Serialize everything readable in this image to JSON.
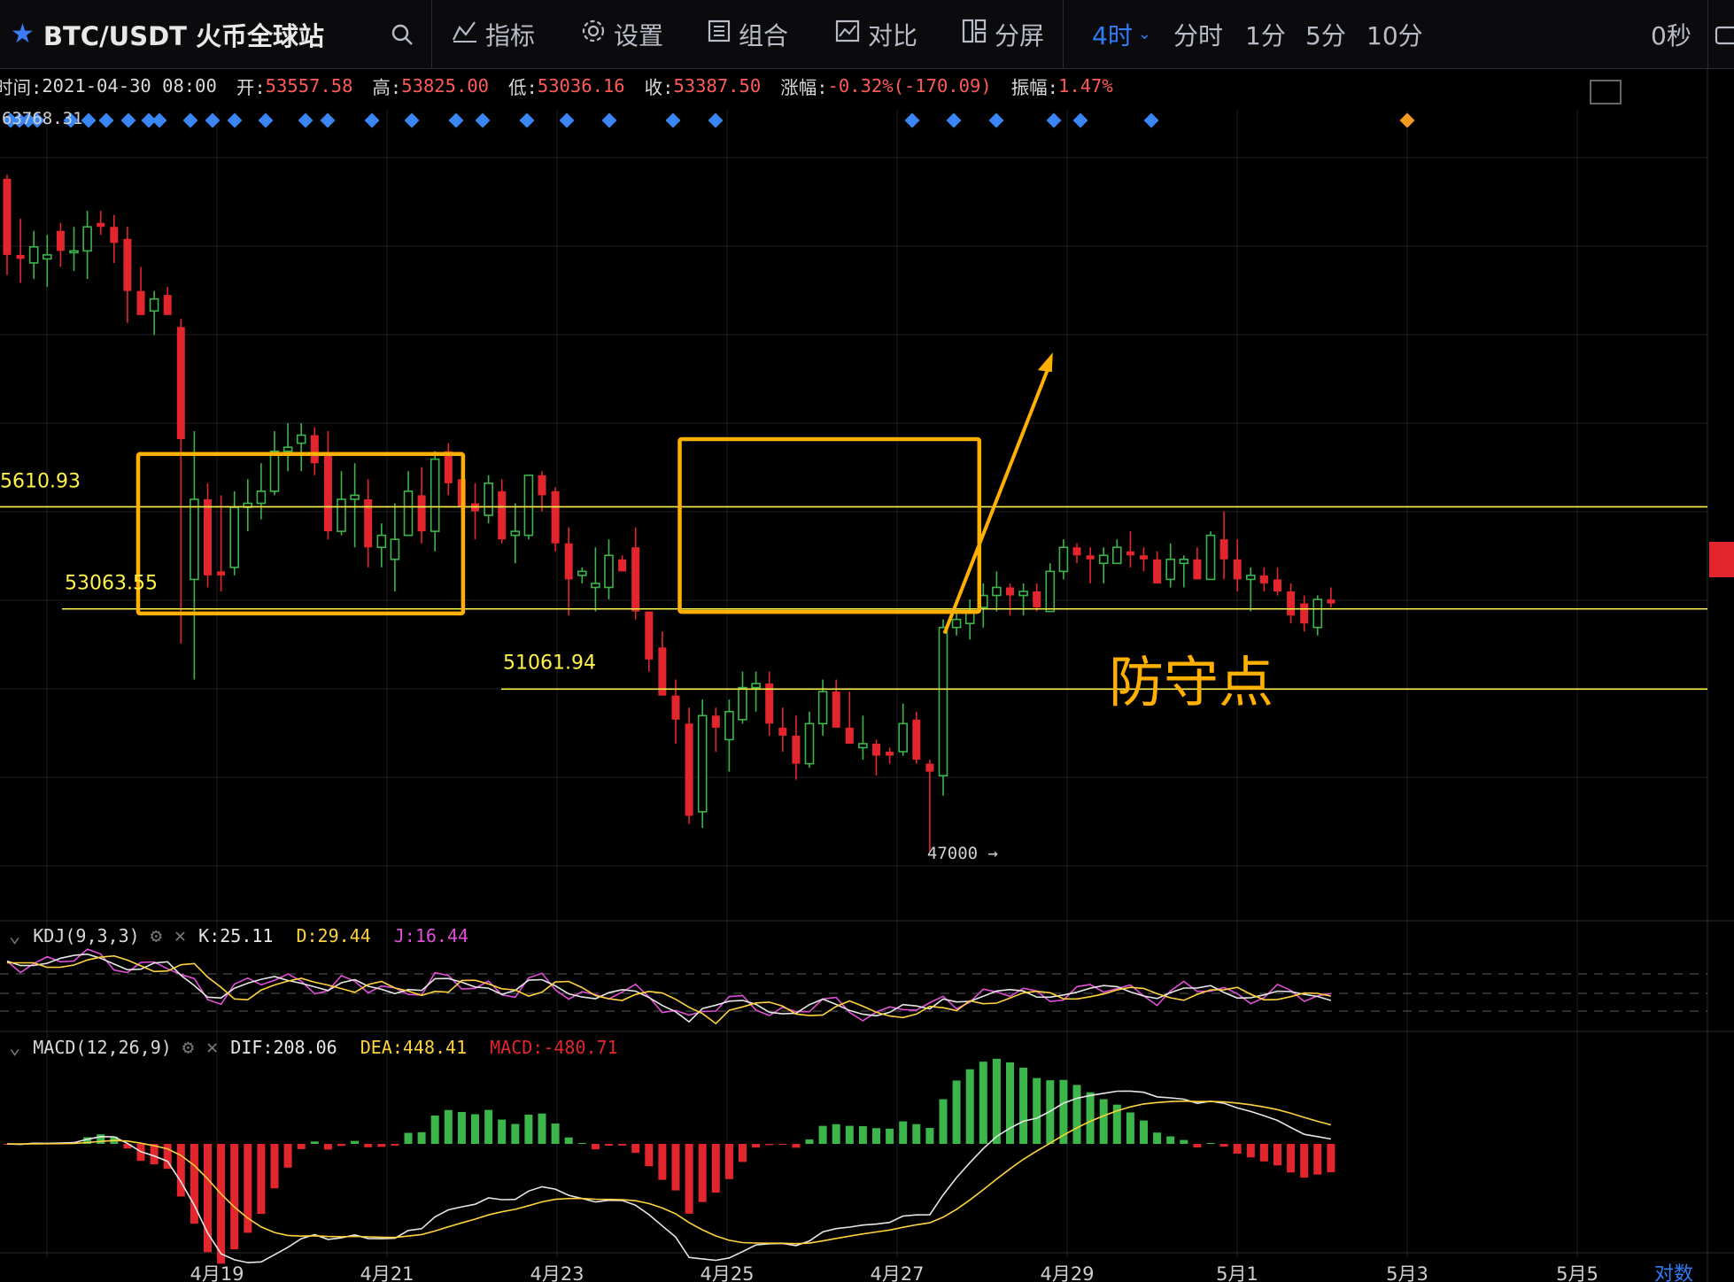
{
  "topbar": {
    "symbol": "BTC/USDT 火币全球站",
    "tools": [
      {
        "label": "指标"
      },
      {
        "label": "设置"
      },
      {
        "label": "组合"
      },
      {
        "label": "对比"
      },
      {
        "label": "分屏"
      }
    ],
    "timeframes": [
      {
        "label": "4时",
        "active": true
      },
      {
        "label": "分时",
        "active": false
      },
      {
        "label": "1分",
        "active": false
      },
      {
        "label": "5分",
        "active": false
      },
      {
        "label": "10分",
        "active": false
      }
    ],
    "countdown": "0秒"
  },
  "ohlc": {
    "time_label": "时间:",
    "time": "2021-04-30 08:00",
    "open_label": "开:",
    "open": "53557.58",
    "high_label": "高:",
    "high": "53825.00",
    "low_label": "低:",
    "low": "53036.16",
    "close_label": "收:",
    "close": "53387.50",
    "change_label": "涨幅:",
    "change": "-0.32%(-170.09)",
    "amp_label": "振幅:",
    "amp": "1.47%"
  },
  "annotations": {
    "top_price": "63768.31",
    "level1": "5610.93",
    "level2": "53063.55",
    "level3": "51061.94",
    "low_marker": "47000 →",
    "defense_text": "防守点"
  },
  "kdj": {
    "name": "KDJ(9,3,3)",
    "k": "K:25.11",
    "d": "D:29.44",
    "j": "J:16.44"
  },
  "macd": {
    "name": "MACD(12,26,9)",
    "dif": "DIF:208.06",
    "dea": "DEA:448.41",
    "macd": "MACD:-480.71"
  },
  "xaxis": {
    "labels": [
      "4月19",
      "4月21",
      "4月23",
      "4月25",
      "4月27",
      "4月29",
      "5月1",
      "5月3",
      "5月5"
    ],
    "scale_label": "对数"
  },
  "colors": {
    "up": "#3cb54a",
    "down": "#e3262d",
    "accent": "#ffb000",
    "level": "#fff34a"
  },
  "chart_data": {
    "type": "candlestick",
    "title": "BTC/USDT",
    "timeframe": "4h",
    "ylim": [
      45500,
      65500
    ],
    "candles": [
      [
        63800,
        63900,
        61400,
        61900
      ],
      [
        61900,
        62800,
        61200,
        61800
      ],
      [
        61700,
        62500,
        61300,
        62100
      ],
      [
        61800,
        62400,
        61100,
        61900
      ],
      [
        62500,
        62700,
        61600,
        62000
      ],
      [
        62000,
        62600,
        61500,
        62000
      ],
      [
        62000,
        63000,
        61300,
        62600
      ],
      [
        62700,
        63000,
        62400,
        62600
      ],
      [
        62600,
        62900,
        61700,
        62200
      ],
      [
        62300,
        62600,
        60200,
        61000
      ],
      [
        61000,
        61600,
        60800,
        60400
      ],
      [
        60500,
        61000,
        59900,
        60800
      ],
      [
        60900,
        61100,
        60600,
        60400
      ],
      [
        60100,
        60300,
        52200,
        57300
      ],
      [
        53800,
        57500,
        51300,
        55800
      ],
      [
        55800,
        56200,
        53600,
        53900
      ],
      [
        54000,
        55900,
        53500,
        53900
      ],
      [
        54100,
        56000,
        53900,
        55600
      ],
      [
        55600,
        56300,
        55000,
        55700
      ],
      [
        55700,
        56700,
        55300,
        56000
      ],
      [
        56000,
        57500,
        55900,
        57000
      ],
      [
        57000,
        57700,
        56500,
        57100
      ],
      [
        57200,
        57700,
        56500,
        57400
      ],
      [
        57400,
        57600,
        56400,
        56700
      ],
      [
        56900,
        57500,
        54800,
        55000
      ],
      [
        55000,
        56500,
        54900,
        55800
      ],
      [
        55800,
        56700,
        54600,
        55900
      ],
      [
        55800,
        56300,
        54100,
        54600
      ],
      [
        54600,
        55200,
        54100,
        54900
      ],
      [
        54300,
        55700,
        53500,
        54800
      ],
      [
        54900,
        56500,
        54900,
        56000
      ],
      [
        55900,
        56600,
        54700,
        55000
      ],
      [
        55000,
        57000,
        54500,
        56800
      ],
      [
        57000,
        57200,
        55900,
        56200
      ],
      [
        56300,
        56500,
        55400,
        55600
      ],
      [
        55700,
        56200,
        54800,
        55500
      ],
      [
        55400,
        56400,
        55200,
        56200
      ],
      [
        56000,
        56300,
        54700,
        54800
      ],
      [
        54900,
        55700,
        54200,
        55000
      ],
      [
        54900,
        56400,
        54800,
        56400
      ],
      [
        56400,
        56500,
        55500,
        55900
      ],
      [
        56000,
        56100,
        54500,
        54700
      ],
      [
        54700,
        55100,
        52900,
        53800
      ],
      [
        53900,
        54100,
        53700,
        54000
      ],
      [
        53600,
        54600,
        53000,
        53700
      ],
      [
        53600,
        54800,
        53300,
        54400
      ],
      [
        54300,
        54400,
        54000,
        54000
      ],
      [
        54600,
        55100,
        52800,
        53000
      ],
      [
        53000,
        52700,
        51500,
        51800
      ],
      [
        52100,
        52500,
        51000,
        50900
      ],
      [
        50900,
        51300,
        49700,
        50300
      ],
      [
        50200,
        50600,
        47700,
        47900
      ],
      [
        48000,
        50800,
        47600,
        50400
      ],
      [
        50400,
        50600,
        49500,
        50100
      ],
      [
        49800,
        50800,
        49000,
        50500
      ],
      [
        50300,
        51500,
        50200,
        51100
      ],
      [
        51100,
        51500,
        50500,
        51200
      ],
      [
        51200,
        51500,
        49900,
        50200
      ],
      [
        50100,
        50600,
        49500,
        49900
      ],
      [
        49900,
        50400,
        48800,
        49200
      ],
      [
        49200,
        50500,
        49100,
        50200
      ],
      [
        50200,
        51300,
        49900,
        51000
      ],
      [
        51000,
        51300,
        50100,
        50100
      ],
      [
        50100,
        51000,
        49700,
        49700
      ],
      [
        49600,
        50400,
        49300,
        49700
      ],
      [
        49700,
        49800,
        48900,
        49400
      ],
      [
        49500,
        49600,
        49200,
        49400
      ],
      [
        49500,
        50700,
        49400,
        50200
      ],
      [
        50300,
        50500,
        49200,
        49300
      ],
      [
        49200,
        49300,
        47000,
        49000
      ],
      [
        48900,
        52800,
        48400,
        52600
      ],
      [
        52600,
        53000,
        52400,
        52800
      ],
      [
        52700,
        53300,
        52300,
        53000
      ],
      [
        53100,
        53700,
        52600,
        53400
      ],
      [
        53400,
        54000,
        53000,
        53600
      ],
      [
        53600,
        53700,
        52900,
        53400
      ],
      [
        53400,
        53700,
        52900,
        53500
      ],
      [
        53500,
        53700,
        53000,
        53100
      ],
      [
        53000,
        54200,
        53100,
        54000
      ],
      [
        54000,
        54800,
        53800,
        54600
      ],
      [
        54600,
        54700,
        54200,
        54400
      ],
      [
        54400,
        54600,
        53700,
        54300
      ],
      [
        54200,
        54600,
        53700,
        54400
      ],
      [
        54200,
        54800,
        54200,
        54600
      ],
      [
        54500,
        55000,
        54100,
        54400
      ],
      [
        54400,
        54600,
        54000,
        54300
      ],
      [
        54300,
        54500,
        53800,
        53700
      ],
      [
        53800,
        54700,
        53600,
        54300
      ],
      [
        54200,
        54400,
        53600,
        54300
      ],
      [
        54300,
        54600,
        53900,
        53800
      ],
      [
        53800,
        55000,
        53900,
        54900
      ],
      [
        54800,
        55500,
        53800,
        54300
      ],
      [
        54300,
        54800,
        53500,
        53800
      ],
      [
        53800,
        54100,
        53000,
        53900
      ],
      [
        53900,
        54100,
        53500,
        53700
      ],
      [
        53800,
        54100,
        53400,
        53500
      ],
      [
        53500,
        53700,
        52700,
        52900
      ],
      [
        53200,
        53400,
        52500,
        52700
      ],
      [
        52600,
        53400,
        52400,
        53300
      ],
      [
        53300,
        53600,
        53100,
        53200
      ]
    ]
  }
}
